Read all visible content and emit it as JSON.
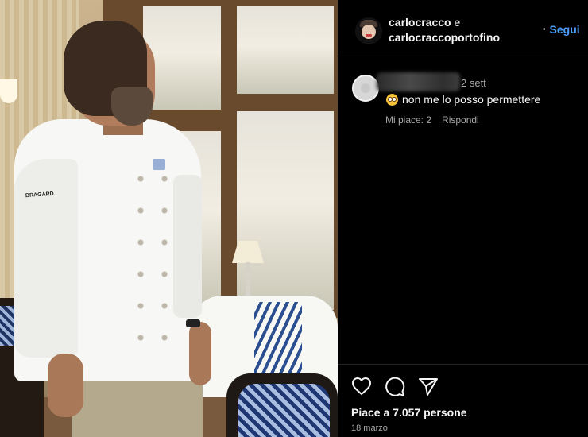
{
  "post": {
    "image_alt": "Chef in white jacket standing by restaurant window",
    "jacket_brand": "BRAGARD"
  },
  "header": {
    "author_primary": "carlocracco",
    "conjunction": "e",
    "author_secondary": "carlocraccoportofino",
    "follow_label": "Segui",
    "separator": "•"
  },
  "comment": {
    "time": "2 sett",
    "text": "non me lo posso permettere",
    "emoji": "flushed-face-emoji",
    "likes_label": "Mi piace: 2",
    "reply_label": "Rispondi"
  },
  "footer": {
    "likes_text": "Piace a 7.057 persone",
    "date": "18 marzo",
    "icons": [
      "heart-icon",
      "comment-icon",
      "share-icon"
    ]
  },
  "colors": {
    "background": "#000000",
    "link": "#4f9df7",
    "secondary_text": "#a8a8a8",
    "primary_text": "#f5f5f5"
  }
}
